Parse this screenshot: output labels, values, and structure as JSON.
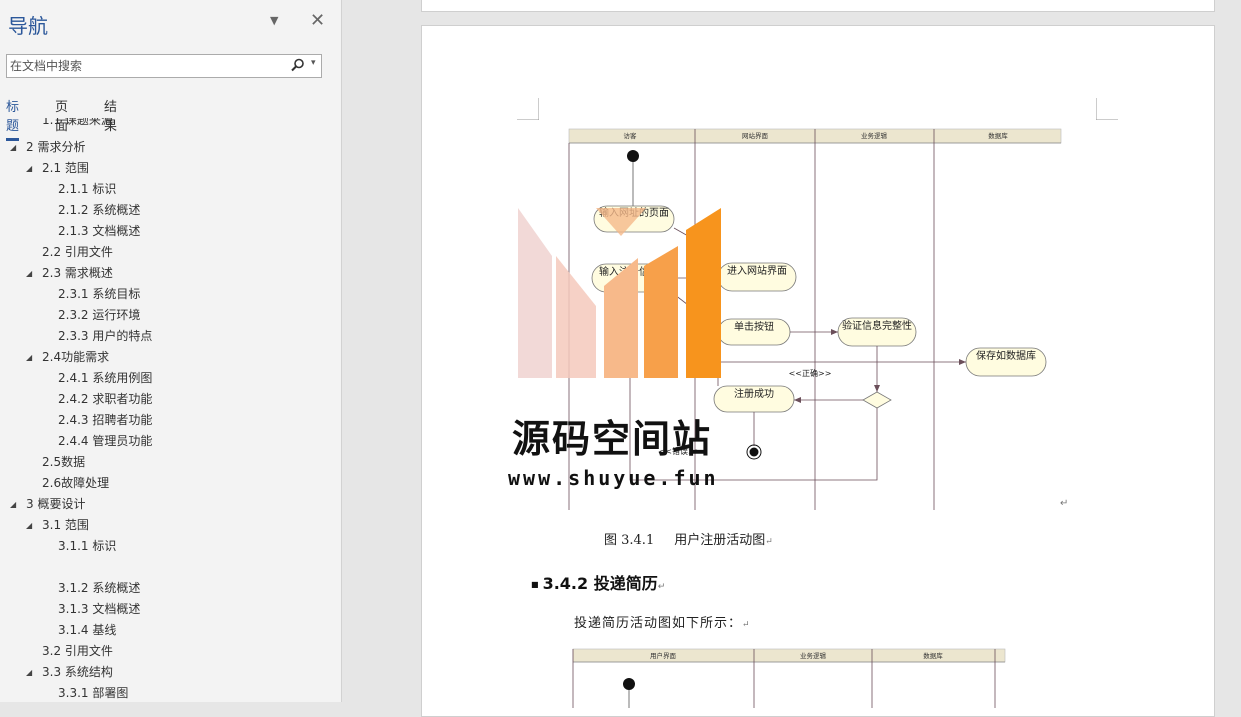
{
  "nav": {
    "title": "导航",
    "search_placeholder": "在文档中搜索",
    "tabs": [
      "标题",
      "页面",
      "结果"
    ],
    "items": [
      {
        "label": "1.1 课题来源",
        "level": 2
      },
      {
        "label": "2 需求分析",
        "level": 1,
        "expandable": true
      },
      {
        "label": "2.1 范围",
        "level": 2,
        "expandable": true
      },
      {
        "label": "2.1.1 标识",
        "level": 3
      },
      {
        "label": "2.1.2 系统概述",
        "level": 3
      },
      {
        "label": "2.1.3 文档概述",
        "level": 3
      },
      {
        "label": "2.2 引用文件",
        "level": 2
      },
      {
        "label": "2.3 需求概述",
        "level": 2,
        "expandable": true
      },
      {
        "label": "2.3.1 系统目标",
        "level": 3
      },
      {
        "label": "2.3.2 运行环境",
        "level": 3
      },
      {
        "label": "2.3.3 用户的特点",
        "level": 3
      },
      {
        "label": "2.4功能需求",
        "level": 2,
        "expandable": true
      },
      {
        "label": "2.4.1 系统用例图",
        "level": 3
      },
      {
        "label": "2.4.2 求职者功能",
        "level": 3
      },
      {
        "label": "2.4.3 招聘者功能",
        "level": 3
      },
      {
        "label": "2.4.4 管理员功能",
        "level": 3
      },
      {
        "label": "2.5数据",
        "level": 2
      },
      {
        "label": "2.6故障处理",
        "level": 2
      },
      {
        "label": "3 概要设计",
        "level": 1,
        "expandable": true
      },
      {
        "label": "3.1 范围",
        "level": 2,
        "expandable": true
      },
      {
        "label": "3.1.1 标识",
        "level": 3
      },
      {
        "label": "",
        "level": 3
      },
      {
        "label": "3.1.2 系统概述",
        "level": 3
      },
      {
        "label": "3.1.3 文档概述",
        "level": 3
      },
      {
        "label": "3.1.4 基线",
        "level": 3
      },
      {
        "label": "3.2 引用文件",
        "level": 2
      },
      {
        "label": "3.3 系统结构",
        "level": 2,
        "expandable": true
      },
      {
        "label": "3.3.1 部署图",
        "level": 3
      }
    ]
  },
  "document": {
    "figure1": {
      "lanes": [
        "访客",
        "网站界面",
        "业务逻辑",
        "数据库"
      ],
      "nodes": {
        "input_url": "输入网址的页面",
        "input_reg": "输入注册信息",
        "enter_site": "进入网站界面",
        "click_btn": "单击按钮",
        "validate": "验证信息完整性",
        "save_db": "保存如数据库",
        "reg_success": "注册成功"
      },
      "guard_correct": "<<正确>>",
      "guard_error": "<<错误>>"
    },
    "caption_num": "图 3.4.1",
    "caption_text": "用户注册活动图",
    "heading": "3.4.2  投递简历",
    "body": "投递简历活动图如下所示：",
    "figure2": {
      "lanes": [
        "用户界面",
        "业务逻辑",
        "数据库"
      ]
    },
    "para_mark": "↵"
  },
  "watermark": {
    "name": "源码空间站",
    "url": "www.shuyue.fun"
  },
  "colors": {
    "accent": "#2b579a",
    "orange": "#f7941d",
    "node_fill": "#fffce0",
    "lane_header": "#ece6cf"
  }
}
